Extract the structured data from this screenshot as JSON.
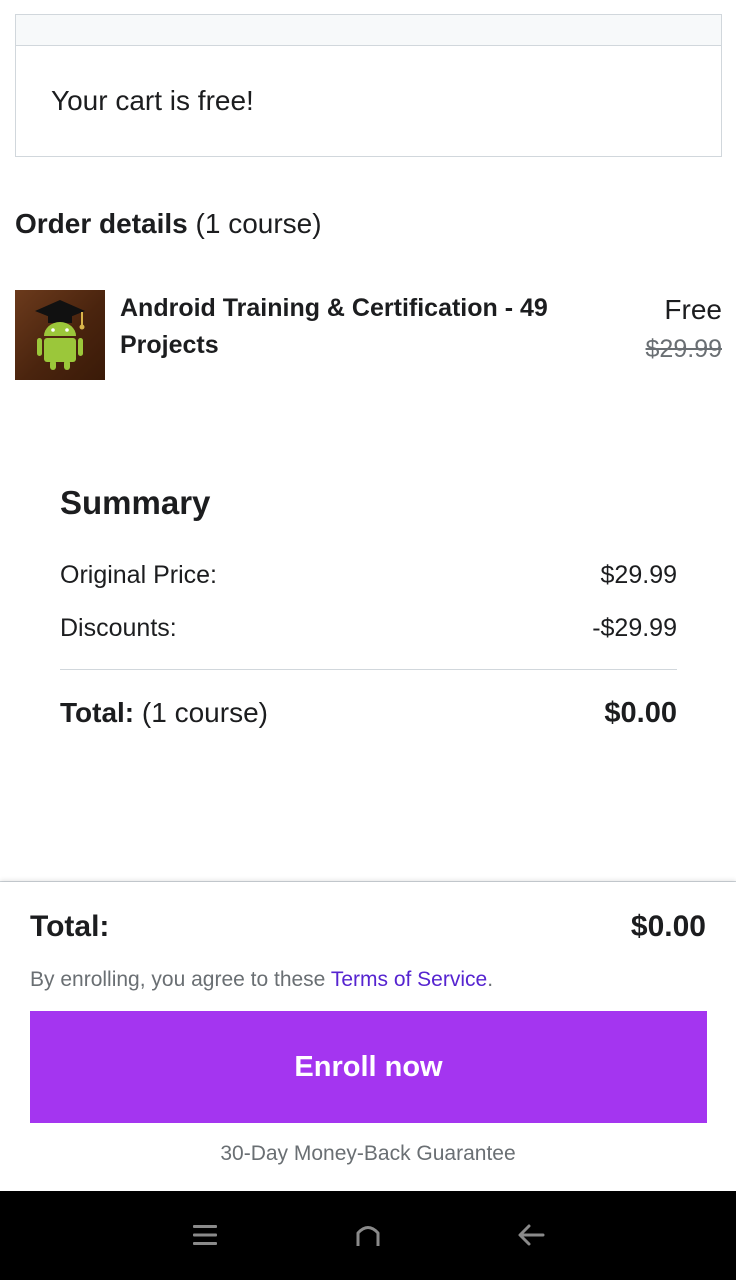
{
  "cart_notice": {
    "message": "Your cart is free!"
  },
  "order_details": {
    "title": "Order details",
    "count": "(1 course)"
  },
  "course": {
    "title": "Android Training & Certification - 49 Projects",
    "price_now": "Free",
    "price_original": "$29.99",
    "thumbnail_icon": "android-graduate-icon"
  },
  "summary": {
    "heading": "Summary",
    "original_price_label": "Original Price:",
    "original_price_value": "$29.99",
    "discounts_label": "Discounts:",
    "discounts_value": "-$29.99",
    "total_label": "Total:",
    "total_count": "(1 course)",
    "total_value": "$0.00"
  },
  "checkout": {
    "total_label": "Total:",
    "total_value": "$0.00",
    "terms_prefix": "By enrolling, you agree to these",
    "terms_link": "Terms of Service",
    "terms_suffix": ".",
    "enroll_label": "Enroll now",
    "guarantee": "30-Day Money-Back Guarantee",
    "accent_color": "#a435f0",
    "link_color": "#5624d0"
  },
  "system_nav": {
    "menu_icon": "menu-icon",
    "home_icon": "home-icon",
    "back_icon": "back-arrow-icon"
  }
}
